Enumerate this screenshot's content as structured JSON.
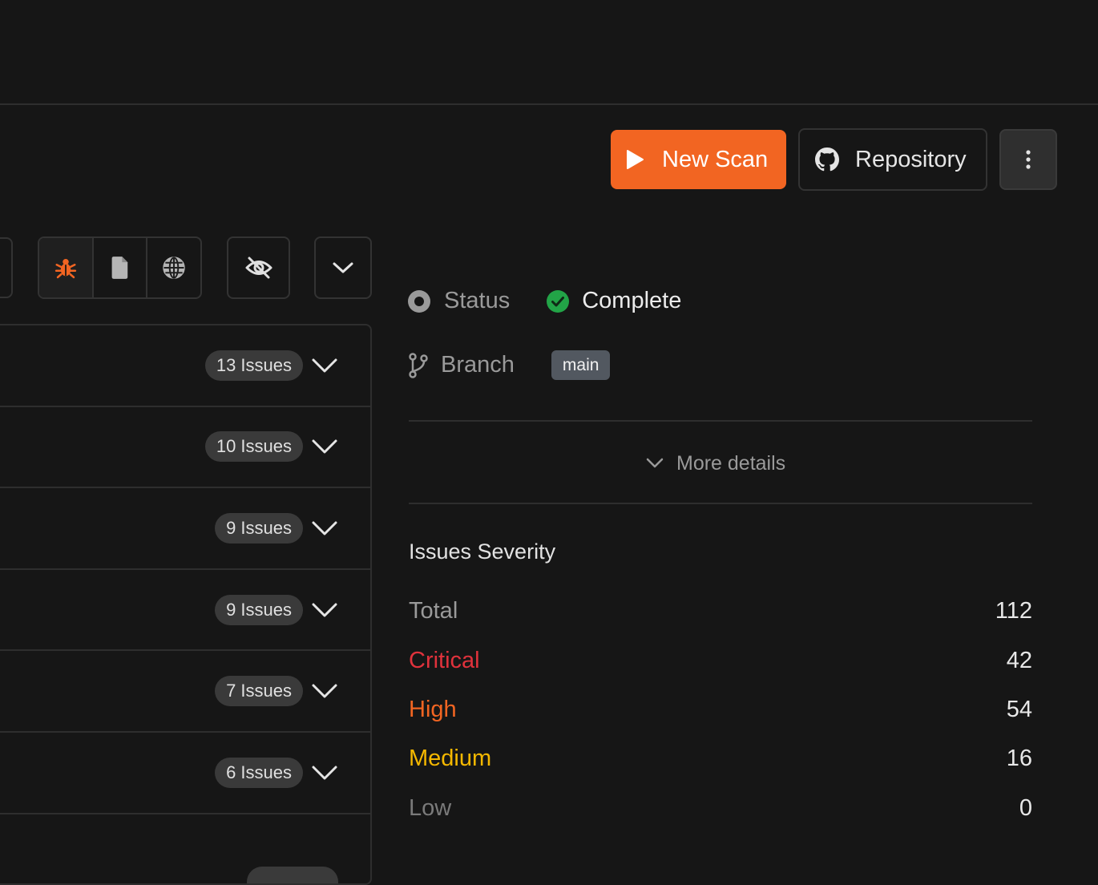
{
  "header": {
    "new_scan_label": "New Scan",
    "repository_label": "Repository",
    "more_icon": "more-vertical-icon"
  },
  "toolbar": {
    "filters": [
      {
        "icon": "bug-icon",
        "active": true,
        "color": "#f26522"
      },
      {
        "icon": "file-icon",
        "active": false
      },
      {
        "icon": "globe-icon",
        "active": false
      }
    ],
    "hide_icon": "eye-off-icon",
    "collapse_icon": "chevron-down-icon"
  },
  "issue_groups": [
    {
      "count_label": "13 Issues"
    },
    {
      "count_label": "10 Issues"
    },
    {
      "count_label": "9 Issues"
    },
    {
      "count_label": "9 Issues"
    },
    {
      "count_label": "7 Issues"
    },
    {
      "count_label": "6 Issues"
    }
  ],
  "details": {
    "status_label": "Status",
    "status_value": "Complete",
    "branch_label": "Branch",
    "branch_value": "main",
    "more_details_label": "More details"
  },
  "severity": {
    "title": "Issues Severity",
    "rows": [
      {
        "label": "Total",
        "count": "112",
        "color": "#9a9a9a"
      },
      {
        "label": "Critical",
        "count": "42",
        "color": "#e0323c"
      },
      {
        "label": "High",
        "count": "54",
        "color": "#f26522"
      },
      {
        "label": "Medium",
        "count": "16",
        "color": "#f5b800"
      },
      {
        "label": "Low",
        "count": "0",
        "color": "#7a7a7a"
      }
    ]
  },
  "colors": {
    "accent": "#f26522",
    "success": "#22a447",
    "background": "#161616"
  }
}
